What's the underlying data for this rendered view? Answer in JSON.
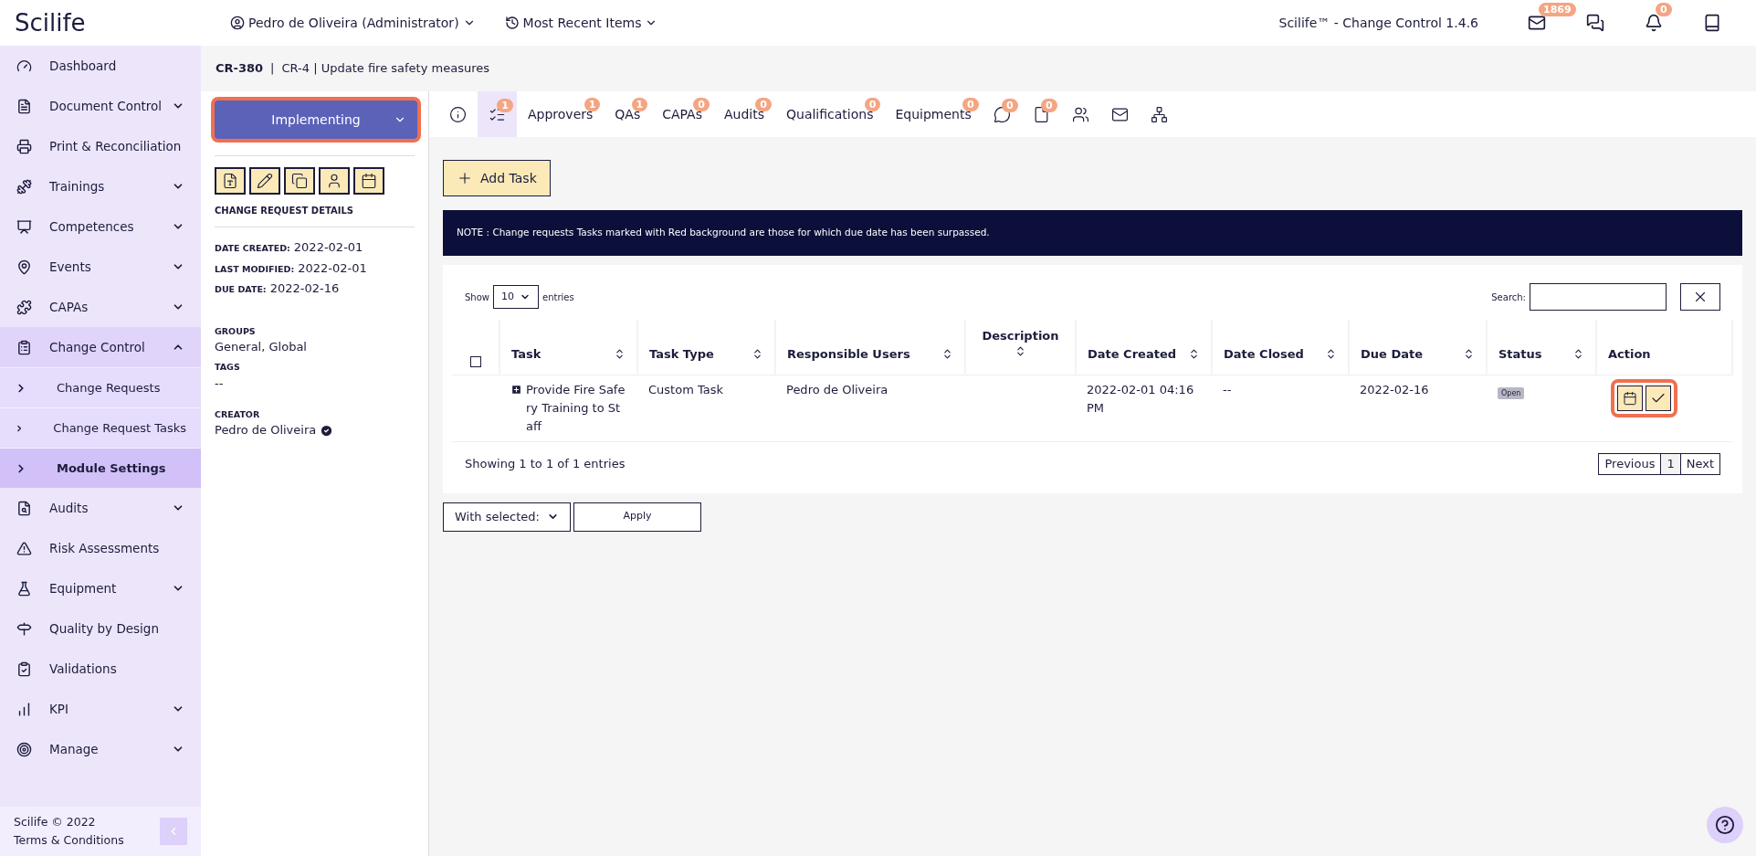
{
  "header": {
    "logo": "Scilife",
    "user": "Pedro de Oliveira (Administrator)",
    "recent": "Most Recent Items",
    "version": "Scilife™ - Change Control 1.4.6",
    "icons": [
      {
        "kind": "mail",
        "badge": "1869"
      },
      {
        "kind": "chat"
      },
      {
        "kind": "bell",
        "badge": "0"
      },
      {
        "kind": "book"
      }
    ]
  },
  "sidebar": {
    "items": [
      {
        "label": "Dashboard",
        "has_menu": false,
        "expanded": false
      },
      {
        "label": "Document Control",
        "has_menu": true,
        "expanded": false
      },
      {
        "label": "Print & Reconciliation",
        "has_menu": false,
        "expanded": false
      },
      {
        "label": "Trainings",
        "has_menu": true,
        "expanded": false
      },
      {
        "label": "Competences",
        "has_menu": true,
        "expanded": false
      },
      {
        "label": "Events",
        "has_menu": true,
        "expanded": false
      },
      {
        "label": "CAPAs",
        "has_menu": true,
        "expanded": false
      },
      {
        "label": "Change Control",
        "has_menu": true,
        "expanded": true,
        "children": [
          {
            "label": "Change Requests",
            "selected": false
          },
          {
            "label": "Change Request Tasks",
            "selected": false
          },
          {
            "label": "Module Settings",
            "selected": true
          }
        ]
      },
      {
        "label": "Audits",
        "has_menu": true,
        "expanded": false
      },
      {
        "label": "Risk Assessments",
        "has_menu": false,
        "expanded": false
      },
      {
        "label": "Equipment",
        "has_menu": true,
        "expanded": false
      },
      {
        "label": "Quality by Design",
        "has_menu": false,
        "expanded": false
      },
      {
        "label": "Validations",
        "has_menu": false,
        "expanded": false
      },
      {
        "label": "KPI",
        "has_menu": true,
        "expanded": false
      },
      {
        "label": "Manage",
        "has_menu": true,
        "expanded": false
      }
    ],
    "footer": {
      "copyright": "Scilife © 2022",
      "terms": "Terms & Conditions"
    }
  },
  "breadcrumb": {
    "id": "CR-380",
    "separator": "|",
    "title": "CR-4 | Update fire safety measures"
  },
  "details": {
    "status": "Implementing",
    "section_title": "CHANGE REQUEST DETAILS",
    "dates": [
      {
        "label": "DATE CREATED:",
        "value": "2022-02-01"
      },
      {
        "label": "LAST MODIFIED:",
        "value": "2022-02-01"
      },
      {
        "label": "DUE DATE:",
        "value": "2022-02-16"
      }
    ],
    "fields": [
      {
        "label": "GROUPS",
        "value": "General, Global",
        "verified": false
      },
      {
        "label": "TAGS",
        "value": "--",
        "verified": false
      },
      {
        "label": "CREATOR",
        "value": "Pedro de Oliveira",
        "verified": true
      }
    ]
  },
  "tabs": [
    {
      "kind": "info",
      "selected": false
    },
    {
      "kind": "tasks",
      "badge": "1",
      "selected": true
    },
    {
      "kind": "text",
      "label": "Approvers",
      "badge": "1",
      "selected": false
    },
    {
      "kind": "text",
      "label": "QAs",
      "badge": "1",
      "selected": false
    },
    {
      "kind": "text",
      "label": "CAPAs",
      "badge": "0",
      "selected": false
    },
    {
      "kind": "text",
      "label": "Audits",
      "badge": "0",
      "selected": false
    },
    {
      "kind": "text",
      "label": "Qualifications",
      "badge": "0",
      "selected": false
    },
    {
      "kind": "text",
      "label": "Equipments",
      "badge": "0",
      "selected": false
    },
    {
      "kind": "comments",
      "badge": "0",
      "selected": false
    },
    {
      "kind": "files",
      "badge": "0",
      "selected": false
    },
    {
      "kind": "users",
      "selected": false
    },
    {
      "kind": "mail",
      "selected": false
    },
    {
      "kind": "tree",
      "selected": false
    }
  ],
  "add_task": "Add Task",
  "note": "NOTE : Change requests Tasks marked with Red background are those for which due date has been surpassed.",
  "table": {
    "select_all_checked": false,
    "show": "Show",
    "page_size": "10",
    "entries": "entries",
    "search_label": "Search:",
    "columns": [
      "Task",
      "Task Type",
      "Responsible Users",
      "Description",
      "Date Created",
      "Date Closed",
      "Due Date",
      "Status",
      "Action"
    ],
    "rows": [
      {
        "checked": false,
        "task": "Provide Fire Safery Training to Staff",
        "task_type": "Custom Task",
        "responsible": "Pedro de Oliveira",
        "description": "",
        "date_created": "2022-02-01 04:16 PM",
        "date_closed": "--",
        "due_date": "2022-02-16",
        "status": "Open"
      }
    ],
    "info": "Showing 1 to 1 of 1 entries",
    "pagination": [
      {
        "label": "Previous",
        "selected": false
      },
      {
        "label": "1",
        "selected": true
      },
      {
        "label": "Next",
        "selected": false
      }
    ]
  },
  "bulk": {
    "select": "With selected:",
    "apply": "Apply"
  }
}
